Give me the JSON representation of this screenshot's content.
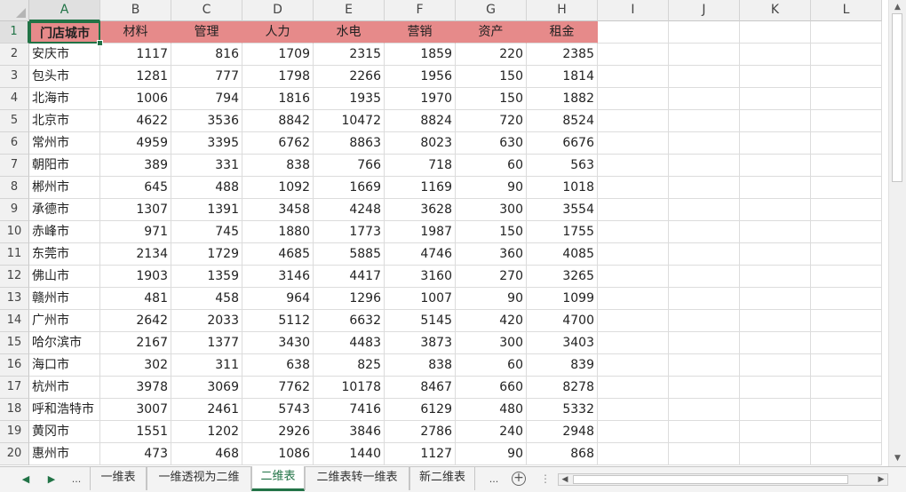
{
  "columns": [
    "A",
    "B",
    "C",
    "D",
    "E",
    "F",
    "G",
    "H",
    "I",
    "J",
    "K",
    "L"
  ],
  "selected_cell": "A1",
  "header_row": [
    "门店城市",
    "材料",
    "管理",
    "人力",
    "水电",
    "营销",
    "资产",
    "租金"
  ],
  "rows": [
    [
      "安庆市",
      "1117",
      "816",
      "1709",
      "2315",
      "1859",
      "220",
      "2385"
    ],
    [
      "包头市",
      "1281",
      "777",
      "1798",
      "2266",
      "1956",
      "150",
      "1814"
    ],
    [
      "北海市",
      "1006",
      "794",
      "1816",
      "1935",
      "1970",
      "150",
      "1882"
    ],
    [
      "北京市",
      "4622",
      "3536",
      "8842",
      "10472",
      "8824",
      "720",
      "8524"
    ],
    [
      "常州市",
      "4959",
      "3395",
      "6762",
      "8863",
      "8023",
      "630",
      "6676"
    ],
    [
      "朝阳市",
      "389",
      "331",
      "838",
      "766",
      "718",
      "60",
      "563"
    ],
    [
      "郴州市",
      "645",
      "488",
      "1092",
      "1669",
      "1169",
      "90",
      "1018"
    ],
    [
      "承德市",
      "1307",
      "1391",
      "3458",
      "4248",
      "3628",
      "300",
      "3554"
    ],
    [
      "赤峰市",
      "971",
      "745",
      "1880",
      "1773",
      "1987",
      "150",
      "1755"
    ],
    [
      "东莞市",
      "2134",
      "1729",
      "4685",
      "5885",
      "4746",
      "360",
      "4085"
    ],
    [
      "佛山市",
      "1903",
      "1359",
      "3146",
      "4417",
      "3160",
      "270",
      "3265"
    ],
    [
      "赣州市",
      "481",
      "458",
      "964",
      "1296",
      "1007",
      "90",
      "1099"
    ],
    [
      "广州市",
      "2642",
      "2033",
      "5112",
      "6632",
      "5145",
      "420",
      "4700"
    ],
    [
      "哈尔滨市",
      "2167",
      "1377",
      "3430",
      "4483",
      "3873",
      "300",
      "3403"
    ],
    [
      "海口市",
      "302",
      "311",
      "638",
      "825",
      "838",
      "60",
      "839"
    ],
    [
      "杭州市",
      "3978",
      "3069",
      "7762",
      "10178",
      "8467",
      "660",
      "8278"
    ],
    [
      "呼和浩特市",
      "3007",
      "2461",
      "5743",
      "7416",
      "6129",
      "480",
      "5332"
    ],
    [
      "黄冈市",
      "1551",
      "1202",
      "2926",
      "3846",
      "2786",
      "240",
      "2948"
    ],
    [
      "惠州市",
      "473",
      "468",
      "1086",
      "1440",
      "1127",
      "90",
      "868"
    ]
  ],
  "row_numbers": [
    "1",
    "2",
    "3",
    "4",
    "5",
    "6",
    "7",
    "8",
    "9",
    "10",
    "11",
    "12",
    "13",
    "14",
    "15",
    "16",
    "17",
    "18",
    "19",
    "20"
  ],
  "header_fill_color": "#e68a8a",
  "accent_color": "#217346",
  "sheet_tabs": {
    "nav_prev": "◀",
    "nav_next": "▶",
    "ellipsis_left": "...",
    "tabs": [
      "一维表",
      "一维透视为二维",
      "二维表",
      "二维表转一维表",
      "新二维表"
    ],
    "active_tab": "二维表",
    "ellipsis_right": "...",
    "add_sheet": "+"
  }
}
